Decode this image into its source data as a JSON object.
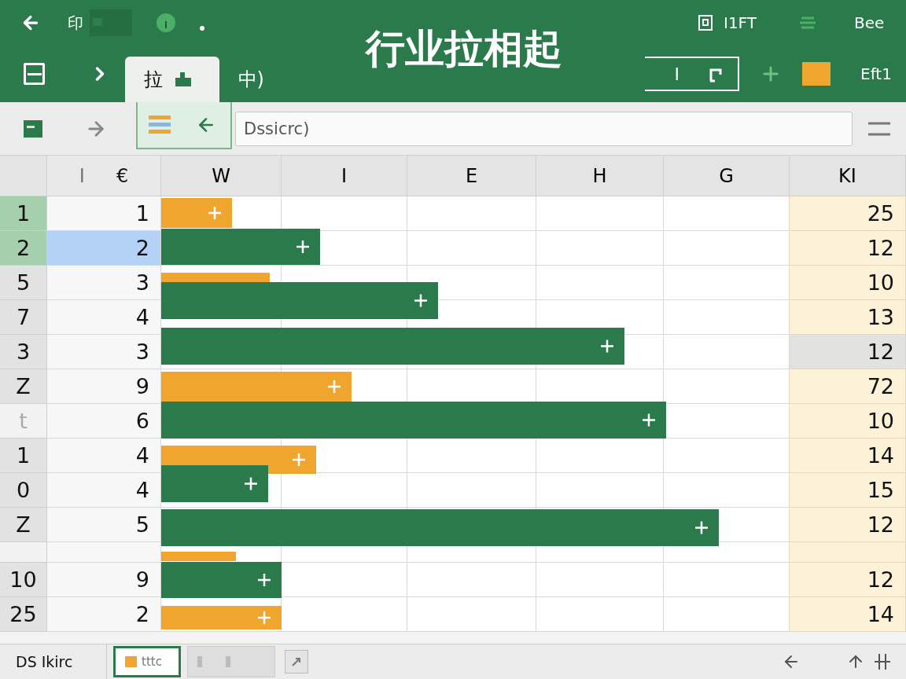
{
  "header": {
    "top_left": [
      "印"
    ],
    "top_right": [
      {
        "label": "I1FT"
      },
      {
        "label": "Bee"
      }
    ],
    "title": "行业拉相起",
    "tabs": [
      {
        "label": "拉",
        "selected": true
      },
      {
        "label": "中)",
        "selected": false
      }
    ],
    "field_text": "I",
    "right_label": "Eft1"
  },
  "formula_bar": {
    "value": "Dssicrc)"
  },
  "columns": [
    {
      "label": "I",
      "suffix": "€"
    },
    {
      "label": "W"
    },
    {
      "label": "I"
    },
    {
      "label": "E"
    },
    {
      "label": "H"
    },
    {
      "label": "G"
    },
    {
      "label": "KI"
    }
  ],
  "rows": [
    {
      "header": "1",
      "value": "1",
      "last": "25",
      "header_selected": true,
      "cell_selected": false,
      "highlighted": false,
      "dimmed": false
    },
    {
      "header": "2",
      "value": "2",
      "last": "12",
      "header_selected": true,
      "cell_selected": true,
      "highlighted": false,
      "dimmed": false
    },
    {
      "header": "5",
      "value": "3",
      "last": "10",
      "header_selected": false,
      "cell_selected": false,
      "highlighted": false,
      "dimmed": false
    },
    {
      "header": "7",
      "value": "4",
      "last": "13",
      "header_selected": false,
      "cell_selected": false,
      "highlighted": false,
      "dimmed": false
    },
    {
      "header": "3",
      "value": "3",
      "last": "12",
      "header_selected": false,
      "cell_selected": false,
      "highlighted": true,
      "dimmed": false
    },
    {
      "header": "Z",
      "value": "9",
      "last": "72",
      "header_selected": false,
      "cell_selected": false,
      "highlighted": false,
      "dimmed": false
    },
    {
      "header": "t",
      "value": "6",
      "last": "10",
      "header_selected": false,
      "cell_selected": false,
      "highlighted": false,
      "dimmed": true
    },
    {
      "header": "1",
      "value": "4",
      "last": "14",
      "header_selected": false,
      "cell_selected": false,
      "highlighted": false,
      "dimmed": false
    },
    {
      "header": "0",
      "value": "4",
      "last": "15",
      "header_selected": false,
      "cell_selected": false,
      "highlighted": false,
      "dimmed": false
    },
    {
      "header": "Z",
      "value": "5",
      "last": "12",
      "header_selected": false,
      "cell_selected": false,
      "highlighted": false,
      "dimmed": false
    },
    {
      "kind": "spacer",
      "header_selected": false,
      "cell_selected": false,
      "highlighted": false,
      "dimmed": true
    },
    {
      "header": "10",
      "value": "9",
      "last": "12",
      "header_selected": false,
      "cell_selected": false,
      "highlighted": false,
      "dimmed": false
    },
    {
      "header": "25",
      "value": "2",
      "last": "14",
      "header_selected": false,
      "cell_selected": false,
      "highlighted": false,
      "dimmed": false
    }
  ],
  "status_bar": {
    "label": "DS Ikirc",
    "sheet_tabs": [
      {
        "kind": "text",
        "label": "tttc",
        "selected": true
      },
      {
        "kind": "blank",
        "selected": false
      }
    ]
  }
}
